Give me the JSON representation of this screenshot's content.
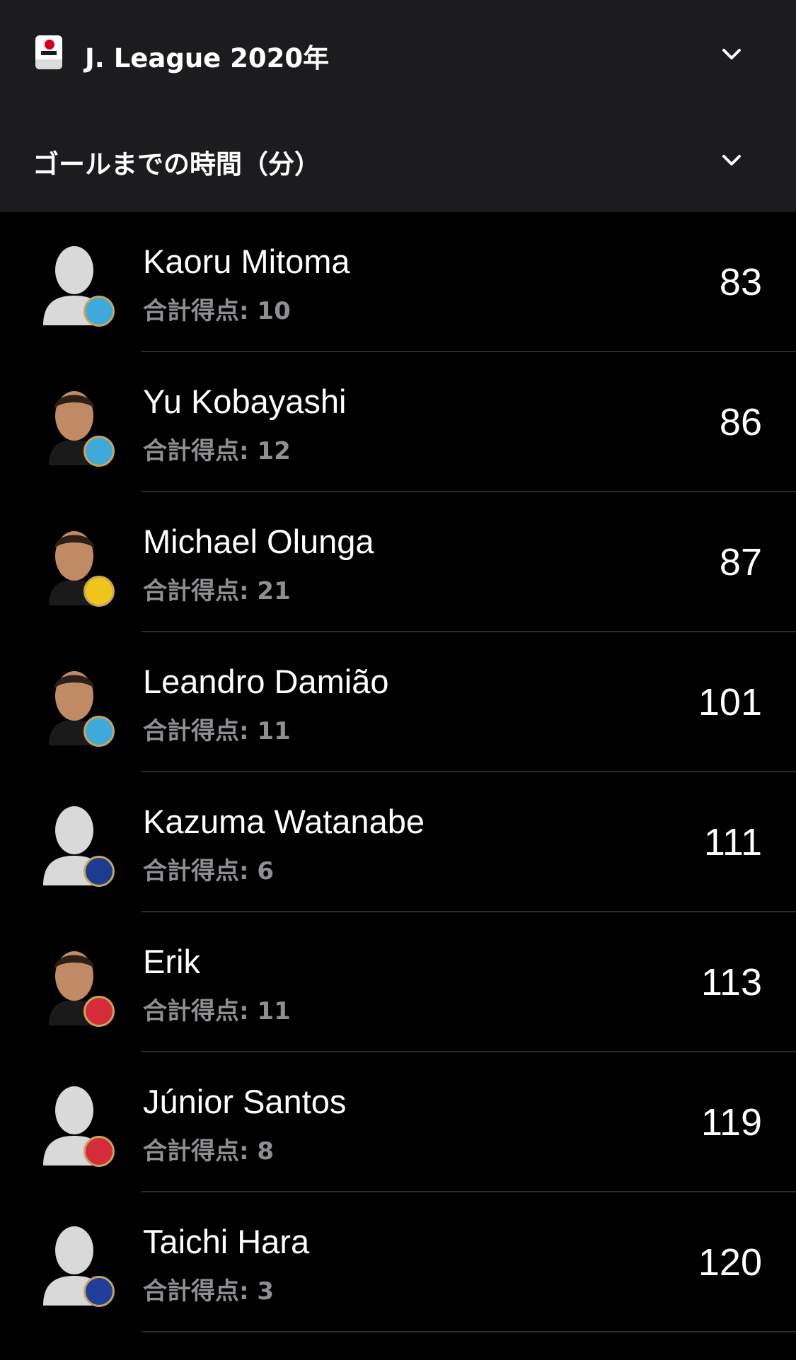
{
  "header": {
    "league_label": "J. League 2020年",
    "stat_label": "ゴールまでの時間（分）"
  },
  "colors": {
    "background": "#000000",
    "header_background": "#1c1c1e",
    "secondary_text": "#8e8e93",
    "divider": "#2c2c2e"
  },
  "players": [
    {
      "name": "Kaoru Mitoma",
      "goals": "合計得点: 10",
      "minutes": "83",
      "photo": "placeholder-silhouette",
      "team_color": "#3fa9dc"
    },
    {
      "name": "Yu Kobayashi",
      "goals": "合計得点: 12",
      "minutes": "86",
      "photo": "player-photo",
      "team_color": "#3fa9dc"
    },
    {
      "name": "Michael Olunga",
      "goals": "合計得点: 21",
      "minutes": "87",
      "photo": "player-photo",
      "team_color": "#f0c419"
    },
    {
      "name": "Leandro Damião",
      "goals": "合計得点: 11",
      "minutes": "101",
      "photo": "player-photo",
      "team_color": "#3fa9dc"
    },
    {
      "name": "Kazuma Watanabe",
      "goals": "合計得点: 6",
      "minutes": "111",
      "photo": "placeholder-silhouette",
      "team_color": "#1d3c8f"
    },
    {
      "name": "Erik",
      "goals": "合計得点: 11",
      "minutes": "113",
      "photo": "player-photo",
      "team_color": "#d62c3a"
    },
    {
      "name": "Júnior Santos",
      "goals": "合計得点: 8",
      "minutes": "119",
      "photo": "placeholder-silhouette",
      "team_color": "#d62c3a"
    },
    {
      "name": "Taichi Hara",
      "goals": "合計得点: 3",
      "minutes": "120",
      "photo": "placeholder-silhouette",
      "team_color": "#1f3f9a"
    }
  ]
}
